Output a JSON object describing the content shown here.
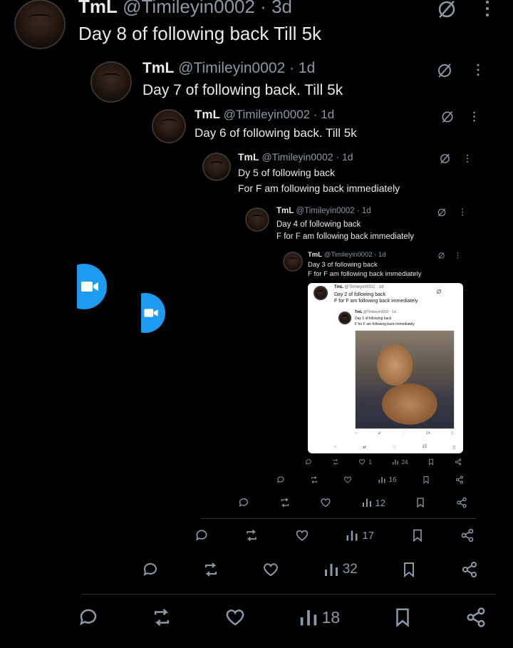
{
  "tweets": [
    {
      "name": "TmL",
      "handle": "@Timileyin0002 · 3d",
      "lines": [
        "Day 8 of following back Till 5k"
      ]
    },
    {
      "name": "TmL",
      "handle": "@Timileyin0002 · 1d",
      "lines": [
        "Day 7 of following back. Till 5k"
      ]
    },
    {
      "name": "TmL",
      "handle": "@Timileyin0002 · 1d",
      "lines": [
        "Day 6 of following back. Till 5k"
      ]
    },
    {
      "name": "TmL",
      "handle": "@Timileyin0002 · 1d",
      "lines": [
        "Dy 5 of following back",
        "For F am following back immediately"
      ]
    },
    {
      "name": "TmL",
      "handle": "@Timileyin0002 · 1d",
      "lines": [
        "Day 4 of following back",
        "F for F am following back immediately"
      ]
    },
    {
      "name": "TmL",
      "handle": "@Timileyin0002 · 1d",
      "lines": [
        "Day 3 of following back",
        "F for F am following back immediately"
      ]
    }
  ],
  "inner_card": {
    "tweet1": {
      "name": "TmL",
      "handle": "@Timileyin0002 · 1d",
      "lines": [
        "Day 2 of following back",
        "F for F am following back immediately"
      ]
    },
    "tweet2": {
      "name": "TmL",
      "handle": "@Timileyin0002 · 1d",
      "lines": [
        "Day 1 of following back",
        "F for F am following back immediately"
      ]
    },
    "metrics1": {
      "views": "14"
    },
    "metrics2": {
      "views": "15"
    }
  },
  "metrics": [
    {
      "like": "1",
      "views": "24"
    },
    {
      "views": "16"
    },
    {
      "views": "12"
    },
    {
      "views": "17"
    },
    {
      "views": "32"
    },
    {
      "views": "18"
    }
  ],
  "colors": {
    "accent": "#1d9bf0",
    "text": "#e7e9ea",
    "muted": "#8b98a5",
    "bg": "#000000"
  },
  "icons": [
    "reply-icon",
    "retweet-icon",
    "like-icon",
    "views-icon",
    "bookmark-icon",
    "share-icon",
    "grok-icon",
    "more-icon",
    "video-camera-icon"
  ]
}
